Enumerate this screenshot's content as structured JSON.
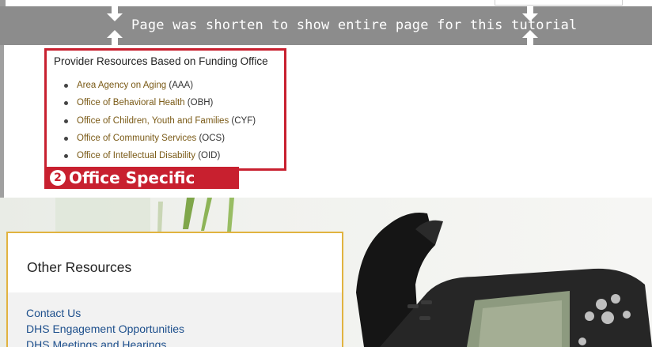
{
  "banner": {
    "text": "Page was shorten to show entire page for this tutorial"
  },
  "provider": {
    "title": "Provider Resources Based on Funding Office",
    "items": [
      {
        "link": "Area Agency on Aging",
        "abbr": " (AAA)"
      },
      {
        "link": "Office of Behavioral Health",
        "abbr": " (OBH)"
      },
      {
        "link": "Office of Children, Youth and Families",
        "abbr": " (CYF)"
      },
      {
        "link": "Office of Community Services",
        "abbr": " (OCS)"
      },
      {
        "link": "Office of Intellectual Disability",
        "abbr": " (OID)"
      }
    ]
  },
  "callout": {
    "number": "2",
    "label": "Office Specific"
  },
  "resources": {
    "heading": "Other Resources",
    "links": [
      "Contact Us",
      "DHS Engagement Opportunities",
      "DHS Meetings and Hearings"
    ]
  },
  "colors": {
    "callout_red": "#c8202f",
    "link_brown": "#7a5a16",
    "link_blue": "#1d4f8c",
    "card_border": "#e1b33f",
    "banner_gray": "#8c8c8c"
  },
  "icons": {
    "banner_left": "double-arrow-vertical-icon",
    "banner_right": "double-arrow-vertical-icon"
  }
}
